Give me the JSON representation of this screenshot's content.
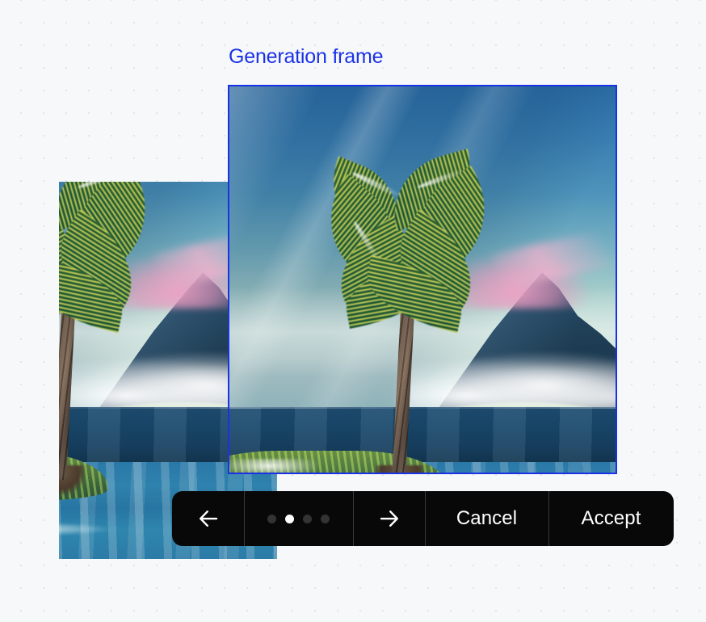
{
  "canvas": {
    "background_color": "#f7f8fa",
    "dot_grid_color": "#e2e4ea"
  },
  "frame": {
    "label": "Generation frame",
    "label_color": "#1a32e6",
    "border_color": "#1a32e6"
  },
  "artwork": {
    "existing_image_alt": "Painted tropical seascape with palm tree on a small green island",
    "generated_image_alt": "Painted seascape continuation with blue mountain, pink lit peak and clouds"
  },
  "toolbar": {
    "prev_icon": "arrow-left-icon",
    "next_icon": "arrow-right-icon",
    "cancel_label": "Cancel",
    "accept_label": "Accept",
    "dots": {
      "count": 4,
      "active_index": 1,
      "active_color": "#ffffff",
      "inactive_color": "#333333"
    },
    "background_color": "#080808",
    "text_color": "#ffffff"
  }
}
